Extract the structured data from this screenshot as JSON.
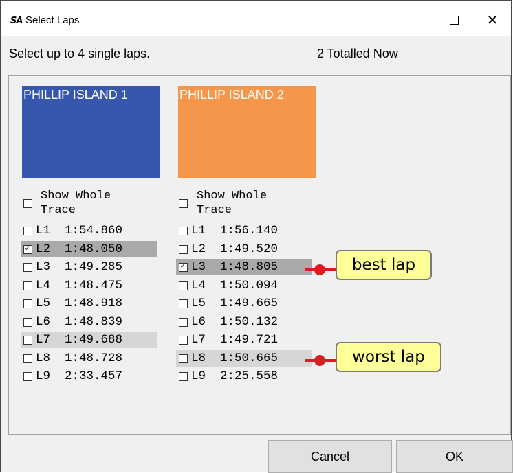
{
  "window": {
    "title": "Select Laps",
    "app_icon": "SA"
  },
  "header": {
    "instruction": "Select up to 4 single laps.",
    "totalled": "2 Totalled Now"
  },
  "colors": {
    "session1": "#3757ae",
    "session2": "#f5964b",
    "callout_bg": "#ffff99",
    "callout_dot": "#d42020"
  },
  "sessions": [
    {
      "name": "PHILLIP ISLAND 1",
      "show_whole_line1": "Show Whole",
      "show_whole_line2": "Trace",
      "show_whole_checked": false,
      "laps": [
        {
          "label": "L1  1:54.860",
          "checked": false,
          "highlight": ""
        },
        {
          "label": "L2  1:48.050",
          "checked": true,
          "highlight": "dark"
        },
        {
          "label": "L3  1:49.285",
          "checked": false,
          "highlight": ""
        },
        {
          "label": "L4  1:48.475",
          "checked": false,
          "highlight": ""
        },
        {
          "label": "L5  1:48.918",
          "checked": false,
          "highlight": ""
        },
        {
          "label": "L6  1:48.839",
          "checked": false,
          "highlight": ""
        },
        {
          "label": "L7  1:49.688",
          "checked": false,
          "highlight": "light"
        },
        {
          "label": "L8  1:48.728",
          "checked": false,
          "highlight": ""
        },
        {
          "label": "L9  2:33.457",
          "checked": false,
          "highlight": ""
        }
      ]
    },
    {
      "name": "PHILLIP ISLAND 2",
      "show_whole_line1": "Show Whole",
      "show_whole_line2": "Trace",
      "show_whole_checked": false,
      "laps": [
        {
          "label": "L1  1:56.140",
          "checked": false,
          "highlight": ""
        },
        {
          "label": "L2  1:49.520",
          "checked": false,
          "highlight": ""
        },
        {
          "label": "L3  1:48.805",
          "checked": true,
          "highlight": "dark"
        },
        {
          "label": "L4  1:50.094",
          "checked": false,
          "highlight": ""
        },
        {
          "label": "L5  1:49.665",
          "checked": false,
          "highlight": ""
        },
        {
          "label": "L6  1:50.132",
          "checked": false,
          "highlight": ""
        },
        {
          "label": "L7  1:49.721",
          "checked": false,
          "highlight": ""
        },
        {
          "label": "L8  1:50.665",
          "checked": false,
          "highlight": "light"
        },
        {
          "label": "L9  2:25.558",
          "checked": false,
          "highlight": ""
        }
      ]
    }
  ],
  "annotations": {
    "best": "best lap",
    "worst": "worst lap"
  },
  "footer": {
    "cancel_label": "Cancel",
    "ok_label": "OK"
  }
}
